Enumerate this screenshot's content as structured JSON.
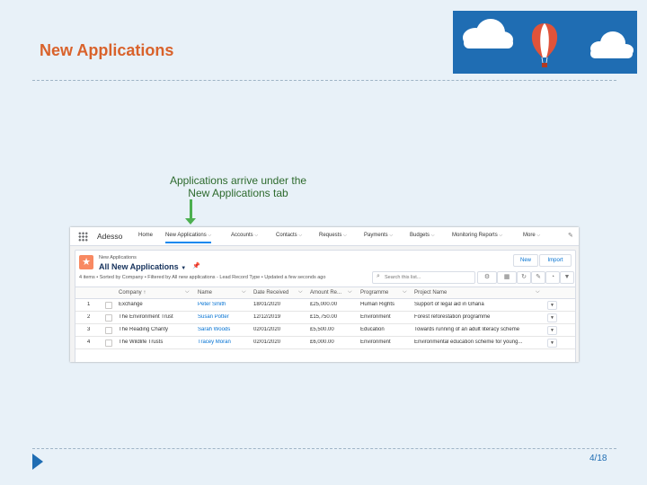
{
  "slide": {
    "title": "New Applications",
    "caption_line1": "Applications arrive under the",
    "caption_line2": "New Applications tab",
    "page": "4/18"
  },
  "colors": {
    "title": "#d9622b",
    "banner": "#1f6db3",
    "accent": "#1589ee",
    "arrow": "#4caf50"
  },
  "salesforce": {
    "app_name": "Adesso",
    "nav_tabs": [
      {
        "label": "Home"
      },
      {
        "label": "New Applications"
      },
      {
        "label": "Accounts"
      },
      {
        "label": "Contacts"
      },
      {
        "label": "Requests"
      },
      {
        "label": "Payments"
      },
      {
        "label": "Budgets"
      },
      {
        "label": "Monitoring Reports"
      },
      {
        "label": "More"
      }
    ],
    "list": {
      "object_label": "New Applications",
      "view_name": "All New Applications",
      "status": "4 items • Sorted by Company • Filtered by All new applications - Lead Record Type • Updated a few seconds ago",
      "new_button": "New",
      "import_button": "Import",
      "search_placeholder": "Search this list...",
      "columns": [
        "Company",
        "Name",
        "Date Received",
        "Amount Re...",
        "Programme",
        "Project Name"
      ],
      "rows": [
        {
          "num": "1",
          "company": "Exchange",
          "name": "Peter Smith",
          "date": "18/01/2020",
          "amount": "£25,000.00",
          "programme": "Human Rights",
          "project": "Support of legal aid in Ghana"
        },
        {
          "num": "2",
          "company": "The Environment Trust",
          "name": "Susan Potter",
          "date": "12/12/2019",
          "amount": "£15,750.00",
          "programme": "Environment",
          "project": "Forest reforestation programme"
        },
        {
          "num": "3",
          "company": "The Reading Charity",
          "name": "Sarah Woods",
          "date": "02/01/2020",
          "amount": "£5,500.00",
          "programme": "Education",
          "project": "Towards running of an adult literacy scheme"
        },
        {
          "num": "4",
          "company": "The Wildlife Trusts",
          "name": "Tracey Moran",
          "date": "02/01/2020",
          "amount": "£6,000.00",
          "programme": "Environment",
          "project": "Environmental education scheme for young..."
        }
      ]
    }
  }
}
